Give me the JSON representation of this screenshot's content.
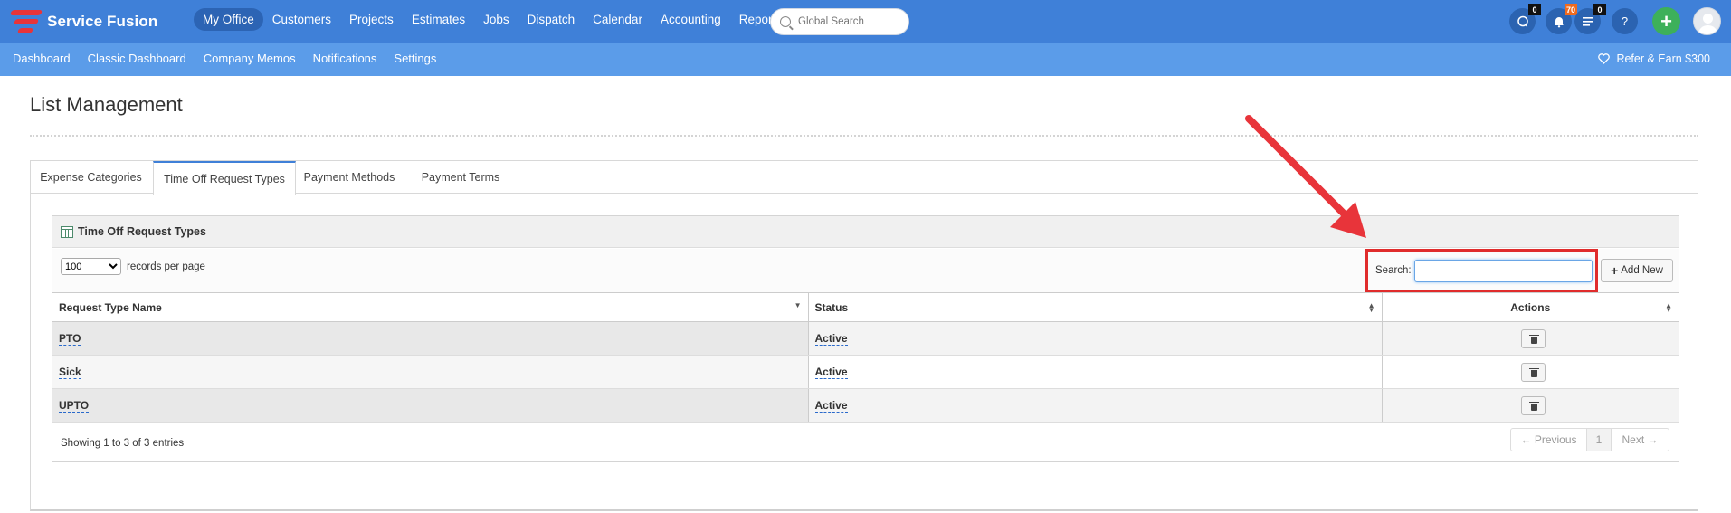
{
  "app": {
    "name": "Service Fusion"
  },
  "topnav": {
    "items": [
      {
        "label": "My Office",
        "active": true
      },
      {
        "label": "Customers"
      },
      {
        "label": "Projects"
      },
      {
        "label": "Estimates"
      },
      {
        "label": "Jobs"
      },
      {
        "label": "Dispatch"
      },
      {
        "label": "Calendar"
      },
      {
        "label": "Accounting"
      },
      {
        "label": "Reports"
      }
    ],
    "search_placeholder": "Global Search",
    "icons": {
      "chat": {
        "icon": "chat-icon",
        "badge": "0"
      },
      "notifications": {
        "icon": "bell-icon",
        "badge": "70"
      },
      "tasks": {
        "icon": "list-icon",
        "badge": "0"
      },
      "help": {
        "icon": "question-icon",
        "label": "?"
      },
      "add": {
        "icon": "plus-icon",
        "label": "+"
      }
    }
  },
  "subnav": {
    "items": [
      "Dashboard",
      "Classic Dashboard",
      "Company Memos",
      "Notifications",
      "Settings"
    ],
    "refer_label": "Refer & Earn $300",
    "refer_icon": "heart-icon"
  },
  "page": {
    "title": "List Management",
    "tabs": [
      {
        "label": "Expense Categories"
      },
      {
        "label": "Time Off Request Types",
        "active": true
      },
      {
        "label": "Payment Methods"
      },
      {
        "label": "Payment Terms"
      }
    ]
  },
  "widget": {
    "title": "Time Off Request Types",
    "records_per_page": "100",
    "records_per_page_label": "records per page",
    "search_label": "Search:",
    "search_value": "",
    "add_new_label": "Add New",
    "columns": [
      "Request Type Name",
      "Status",
      "Actions"
    ],
    "rows": [
      {
        "name": "PTO",
        "status": "Active"
      },
      {
        "name": "Sick",
        "status": "Active"
      },
      {
        "name": "UPTO",
        "status": "Active"
      }
    ],
    "info": "Showing 1 to 3 of 3 entries",
    "pager": {
      "prev": "← Previous",
      "page": "1",
      "next": "Next →"
    }
  },
  "colors": {
    "topbar": "#3f80d8",
    "subbar": "#5b9ce9",
    "highlight_box": "#e02c2c",
    "arrow": "#e8343a",
    "add_button": "#3db05a",
    "badge_orange": "#f06a1e"
  }
}
